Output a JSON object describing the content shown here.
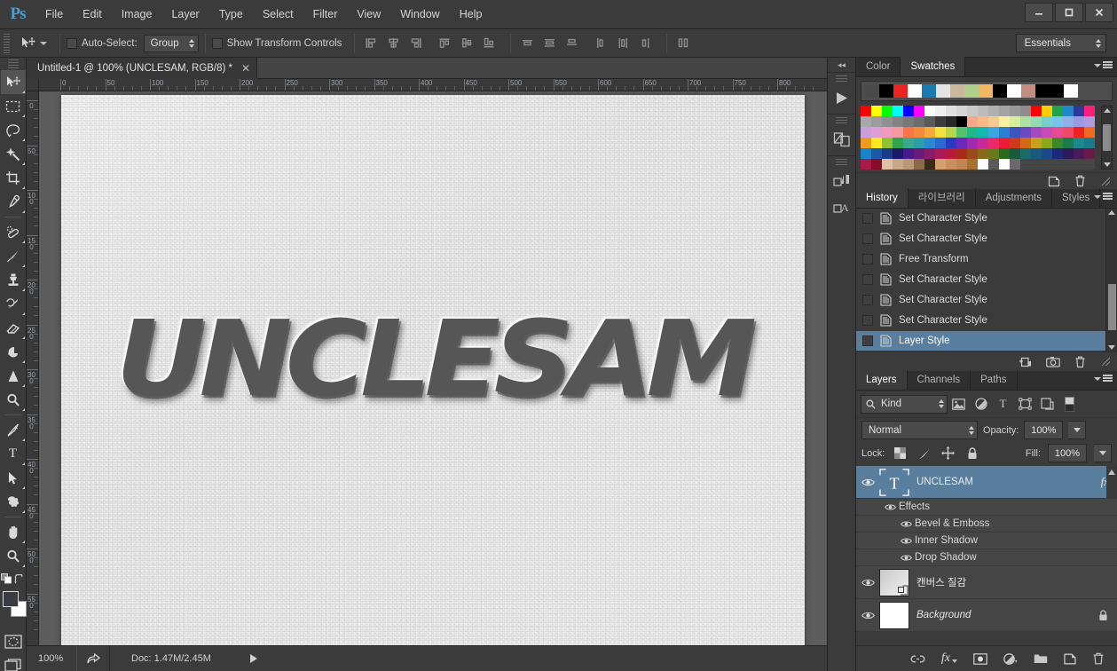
{
  "app": {
    "logo": "Ps",
    "menus": [
      "File",
      "Edit",
      "Image",
      "Layer",
      "Type",
      "Select",
      "Filter",
      "View",
      "Window",
      "Help"
    ],
    "window_controls": {
      "minimize": "minimize-button",
      "maximize": "maximize-button",
      "close": "close-button"
    }
  },
  "options_bar": {
    "tool_icon": "move-tool-icon",
    "auto_select_label": "Auto-Select:",
    "auto_select_value": "Group",
    "show_transform_label": "Show Transform Controls",
    "align_icons": [
      "align-left-edges-icon",
      "align-horizontal-centers-icon",
      "align-right-edges-icon",
      "align-top-edges-icon",
      "align-vertical-centers-icon",
      "align-bottom-edges-icon",
      "distribute-top-edges-icon",
      "distribute-vertical-centers-icon",
      "distribute-bottom-edges-icon",
      "distribute-left-edges-icon",
      "distribute-horizontal-centers-icon",
      "distribute-right-edges-icon",
      "auto-align-layers-icon"
    ],
    "workspace": "Essentials"
  },
  "toolbar": {
    "tools": [
      {
        "name": "move-tool",
        "active": true
      },
      {
        "name": "rectangular-marquee-tool",
        "active": false
      },
      {
        "name": "lasso-tool",
        "active": false
      },
      {
        "name": "magic-wand-tool",
        "active": false
      },
      {
        "name": "crop-tool",
        "active": false
      },
      {
        "name": "eyedropper-tool",
        "active": false
      },
      {
        "name": "spot-healing-brush-tool",
        "active": false
      },
      {
        "name": "brush-tool",
        "active": false
      },
      {
        "name": "clone-stamp-tool",
        "active": false
      },
      {
        "name": "history-brush-tool",
        "active": false
      },
      {
        "name": "eraser-tool",
        "active": false
      },
      {
        "name": "gradient-tool",
        "active": false
      },
      {
        "name": "blur-tool",
        "active": false
      },
      {
        "name": "dodge-tool",
        "active": false
      },
      {
        "name": "pen-tool",
        "active": false
      },
      {
        "name": "horizontal-type-tool",
        "active": false
      },
      {
        "name": "path-selection-tool",
        "active": false
      },
      {
        "name": "custom-shape-tool",
        "active": false
      },
      {
        "name": "hand-tool",
        "active": false
      },
      {
        "name": "zoom-tool",
        "active": false
      }
    ],
    "foreground_color": "#3a3a44",
    "background_color": "#ffffff",
    "quick_mask": "quick-mask-mode-icon",
    "screen_mode": "screen-mode-icon"
  },
  "document": {
    "tab_title": "Untitled-1 @ 100% (UNCLESAM, RGB/8) *",
    "artwork_text": "UNCLESAM",
    "ruler_h_labels": [
      "0",
      "50",
      "100",
      "150",
      "200",
      "250",
      "300",
      "350",
      "400",
      "450",
      "500",
      "550",
      "600",
      "650",
      "700",
      "750",
      "800"
    ],
    "ruler_v_labels": [
      "0",
      "50",
      "100",
      "150",
      "200",
      "250",
      "300",
      "350",
      "400",
      "450",
      "500",
      "550"
    ]
  },
  "status_bar": {
    "zoom": "100%",
    "share_icon": "share-icon",
    "doc_info": "Doc: 1.47M/2.45M",
    "arrow_icon": "expand-arrow-icon"
  },
  "mini_dock": {
    "collapse_icon": "collapse-panels-icon",
    "buttons": [
      "play-actions-icon",
      "brush-presets-icon",
      "paragraph-panel-icon",
      "character-panel-icon"
    ]
  },
  "swatches_panel": {
    "tabs": [
      {
        "label": "Color",
        "active": false
      },
      {
        "label": "Swatches",
        "active": true
      }
    ],
    "menu_icon": "panel-menu-icon",
    "recent_colors": [
      "#4a4a4a",
      "#000000",
      "#ee2222",
      "#ffffff",
      "#1b7bb0",
      "#e3e3e3",
      "#cdb79e",
      "#afd08a",
      "#f0b860",
      "#000000",
      "#ffffff",
      "#c08d80",
      "#000000",
      "#000000",
      "#ffffff"
    ],
    "grid_colors": [
      "#ff0000",
      "#ffff00",
      "#00ff00",
      "#00ffff",
      "#0000ff",
      "#ff00ff",
      "#ffffff",
      "#efefef",
      "#e0e0e0",
      "#d4d4d4",
      "#c8c8c8",
      "#bcbcbc",
      "#b0b0b0",
      "#a4a4a4",
      "#999999",
      "#8d8d8d",
      "#ff0000",
      "#ffcc00",
      "#22a04a",
      "#1f88c8",
      "#2b3a9c",
      "#ff1e7a",
      "#a8a8a8",
      "#9c9c9c",
      "#909090",
      "#848484",
      "#787878",
      "#6c6c6c",
      "#5a5a5a",
      "#3c3c3c",
      "#282828",
      "#000000",
      "#f6a98a",
      "#f8b888",
      "#f6c995",
      "#faeea0",
      "#d8ee9a",
      "#aee0a2",
      "#96d9b2",
      "#77d0cc",
      "#79c5ea",
      "#8fb0e8",
      "#9a9ae0",
      "#b09ae0",
      "#c89fdd",
      "#dd9ed8",
      "#f09ac0",
      "#f59aa0",
      "#f5764a",
      "#f58a3c",
      "#f5a83c",
      "#f5e23c",
      "#b9d64a",
      "#58bf6a",
      "#20b884",
      "#14b8b0",
      "#3aa8e0",
      "#2a7fd0",
      "#3b55c0",
      "#6a4ac0",
      "#a24ac0",
      "#c84ab8",
      "#e84a92",
      "#f04a6a",
      "#ee2222",
      "#f06a22",
      "#f09a22",
      "#fbe91f",
      "#8fc131",
      "#2fa44a",
      "#3aa88a",
      "#2a9fa8",
      "#2a8ad0",
      "#2a6ad0",
      "#2a3ac0",
      "#6a2ac0",
      "#a02ab0",
      "#c82a9a",
      "#e82a6a",
      "#ee1a3a",
      "#cf3a1a",
      "#d4691a",
      "#c8a01a",
      "#8aa81a",
      "#3a8a2a",
      "#1a7a4a",
      "#1a8a8a",
      "#1a7a8a",
      "#1a84c8",
      "#1a5aa8",
      "#1a3a8a",
      "#1a1a6a",
      "#4a1a8a",
      "#6a1a7a",
      "#8a1a6a",
      "#a81a5a",
      "#b81a3a",
      "#a82a1a",
      "#9a4a1a",
      "#8a6a1a",
      "#6a7a1a",
      "#2a6a1a",
      "#1a5a3a",
      "#1a6a6a",
      "#1a5a7a",
      "#1a4a8a",
      "#1a2a7a",
      "#2a1a5a",
      "#4a1a5a",
      "#6a1a4a",
      "#a81a4a",
      "#8a0a2a",
      "#e0c0a0",
      "#c8a888",
      "#b89878",
      "#8a6a4a",
      "#3a2a1a",
      "#d4a070",
      "#c89060",
      "#c08850",
      "#a87030",
      "#ffffff",
      "#5a5a5a",
      "#ffffff",
      "#6a6a6a",
      "#454545",
      "#454545",
      "#454545",
      "#454545",
      "#454545",
      "#454545",
      "#454545"
    ],
    "footer_icons": [
      "new-swatch-icon",
      "delete-swatch-icon"
    ]
  },
  "history_panel": {
    "tabs": [
      {
        "label": "History",
        "active": true
      },
      {
        "label": "라이브러리",
        "active": false
      },
      {
        "label": "Adjustments",
        "active": false
      },
      {
        "label": "Styles",
        "active": false
      }
    ],
    "menu_icon": "panel-menu-icon",
    "items": [
      {
        "label": "Set Character Style",
        "selected": false
      },
      {
        "label": "Set Character Style",
        "selected": false
      },
      {
        "label": "Free Transform",
        "selected": false
      },
      {
        "label": "Set Character Style",
        "selected": false
      },
      {
        "label": "Set Character Style",
        "selected": false
      },
      {
        "label": "Set Character Style",
        "selected": false
      },
      {
        "label": "Layer Style",
        "selected": true
      }
    ],
    "footer_icons": [
      "create-document-from-state-icon",
      "create-snapshot-icon",
      "delete-state-icon"
    ]
  },
  "layers_panel": {
    "tabs": [
      {
        "label": "Layers",
        "active": true
      },
      {
        "label": "Channels",
        "active": false
      },
      {
        "label": "Paths",
        "active": false
      }
    ],
    "menu_icon": "panel-menu-icon",
    "filter_kind": "Kind",
    "filter_icons": [
      "filter-pixel-icon",
      "filter-adjustment-icon",
      "filter-type-icon",
      "filter-shape-icon",
      "filter-smart-object-icon",
      "filter-toggle-icon"
    ],
    "blend_mode": "Normal",
    "opacity_label": "Opacity:",
    "opacity_value": "100%",
    "lock_label": "Lock:",
    "lock_icons": [
      "lock-transparent-pixels-icon",
      "lock-image-pixels-icon",
      "lock-position-icon",
      "lock-all-icon"
    ],
    "fill_label": "Fill:",
    "fill_value": "100%",
    "layers": [
      {
        "name": "UNCLESAM",
        "type": "text",
        "selected": true,
        "visible": true,
        "has_fx": true,
        "fx_badge": "fx"
      },
      {
        "name": "캔버스 질감",
        "type": "raster",
        "selected": false,
        "visible": true,
        "has_fx": false
      },
      {
        "name": "Background",
        "type": "background",
        "selected": false,
        "visible": true,
        "locked": true
      }
    ],
    "effects_group_label": "Effects",
    "effects": [
      "Bevel & Emboss",
      "Inner Shadow",
      "Drop Shadow"
    ],
    "footer_icons": [
      "link-layers-icon",
      "add-layer-style-icon",
      "add-layer-mask-icon",
      "new-adjustment-layer-icon",
      "new-group-icon",
      "new-layer-icon",
      "delete-layer-icon"
    ]
  },
  "colors": {
    "panel_bg": "#3b3b3b",
    "list_bg": "#454545",
    "selection": "#5a7f9e",
    "accent": "#4a9fd4",
    "canvas_bg": "#5d5d5d"
  }
}
